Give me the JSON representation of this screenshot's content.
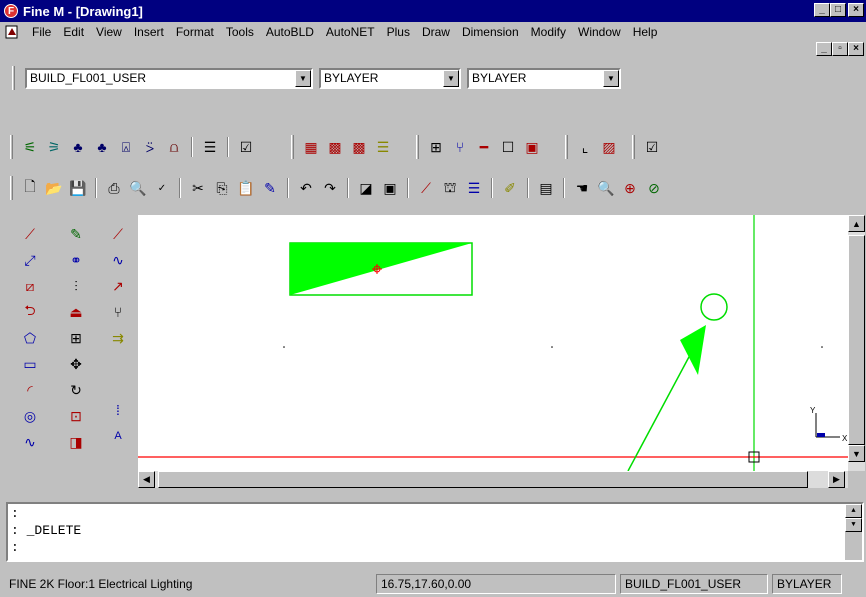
{
  "window": {
    "title": "Fine M - [Drawing1]",
    "app_icon": "F",
    "buttons": [
      "_",
      "□",
      "×"
    ]
  },
  "menu": {
    "items": [
      "File",
      "Edit",
      "View",
      "Insert",
      "Format",
      "Tools",
      "AutoBLD",
      "AutoNET",
      "Plus",
      "Draw",
      "Dimension",
      "Modify",
      "Window",
      "Help"
    ],
    "mdi_buttons": [
      "_",
      "▫",
      "×"
    ]
  },
  "layer_toolbar": {
    "layer": "BUILD_FL001_USER",
    "color": "BYLAYER",
    "linetype": "BYLAYER"
  },
  "colors": {
    "title_bg": "#000080",
    "fill_green": "#00ff00",
    "line_green": "#00dd00",
    "axis_red": "#ff0000",
    "face": "#c0c0c0"
  },
  "command": {
    "lines": [
      ":",
      ": _DELETE",
      ":"
    ]
  },
  "status": {
    "info": "FINE 2K Floor:1 Electrical Lighting",
    "coords": "16.75,17.60,0.00",
    "layer": "BUILD_FL001_USER",
    "linetype": "BYLAYER"
  },
  "ucs": {
    "x": "X",
    "y": "Y"
  }
}
